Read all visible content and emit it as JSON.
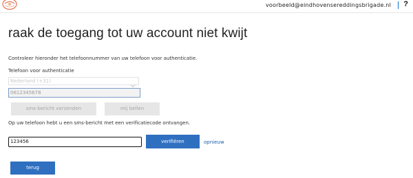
{
  "header": {
    "user_email": "voorbeeld@eindhovensereddingsbrigade.nl",
    "help_label": "?"
  },
  "main": {
    "title": "raak de toegang tot uw account niet kwijt",
    "description": "Controleer hieronder het telefoonnummer van uw telefoon voor authenticatie.",
    "phone_label": "Telefoon voor authenticatie",
    "country_selected": "Nederland (+31)",
    "phone_value": "0612345678",
    "sms_button": "sms-bericht verzenden",
    "call_button": "mij bellen",
    "sms_info": "Op uw telefoon hebt u een sms-bericht met een verificatiecode ontvangen.",
    "code_value": "123456",
    "verify_button": "verifiëren",
    "retry_link": "opnieuw",
    "back_button": "terug"
  },
  "colors": {
    "accent": "#2f6fc0",
    "link": "#1a5ea8",
    "disabled_bg": "#e6e6e6",
    "disabled_text": "#a6a6a6"
  },
  "icons": {
    "logo": "brigade-logo-icon",
    "chevron": "chevron-down-icon"
  }
}
